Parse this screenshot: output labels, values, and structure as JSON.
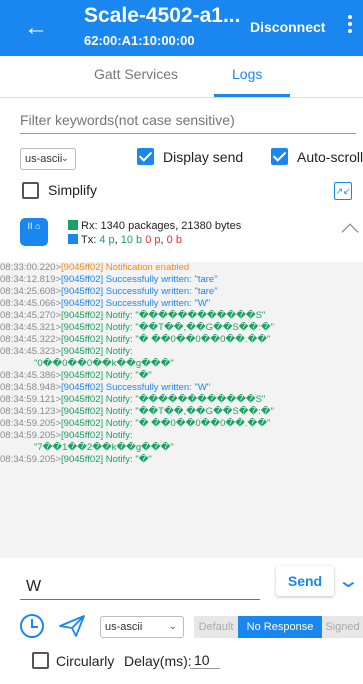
{
  "appbar": {
    "title": "Scale-4502-a1...",
    "address": "62:00:A1:10:00:00",
    "disconnect_label": "Disconnect",
    "back_icon": "arrow-left-icon",
    "more_icon": "more-vert-icon"
  },
  "tabs": [
    {
      "label": "Gatt Services",
      "selected": false
    },
    {
      "label": "Logs",
      "selected": true
    }
  ],
  "filter": {
    "placeholder": "Filter keywords(not case sensitive)",
    "value": ""
  },
  "options": {
    "encoding": "us-ascii",
    "display_send_label": "Display send",
    "display_send_checked": true,
    "auto_scroll_label": "Auto-scroll",
    "auto_scroll_checked": true,
    "simplify_label": "Simplify",
    "simplify_checked": false
  },
  "stats": {
    "icon_text": "II ⌂",
    "rx_label": "Rx: 1340 packages, 21380 bytes",
    "tx_prefix": "Tx: ",
    "tx_pkgs": "4 p",
    "tx_bytes": "10 b",
    "tx_p2": "0 p",
    "tx_b2": "0 b",
    "rx_color": "#1aa060",
    "tx_color": "#1a86f0"
  },
  "logs": [
    {
      "time": "08:33:00.220>",
      "msg": "[9045ff02] Notification enabled",
      "color": "orange"
    },
    {
      "time": "08:34:12.819>",
      "msg": "[9045ff02] Successfully written: \"tare\"",
      "color": "blue"
    },
    {
      "time": "08:34:25.608>",
      "msg": "[9045ff02] Successfully written: \"tare\"",
      "color": "blue"
    },
    {
      "time": "08:34:45.066>",
      "msg": "[9045ff02] Successfully written: \"W\"",
      "color": "blue"
    },
    {
      "time": "08:34:45.270>",
      "msg": "[9045ff02] Notify: \"������������S\"",
      "color": "green"
    },
    {
      "time": "08:34:45.321>",
      "msg": "[9045ff02] Notify: \"��T��,��G��S��:�\"",
      "color": "green"
    },
    {
      "time": "08:34:45.322>",
      "msg": "[9045ff02] Notify: \"� ��0��0��0��.��\"",
      "color": "green"
    },
    {
      "time": "08:34:45.323>",
      "msg": "[9045ff02] Notify:",
      "color": "green"
    },
    {
      "time": "",
      "msg": "\"0��0��0��k��g���\"",
      "color": "green"
    },
    {
      "time": "08:34:45.386>",
      "msg": "[9045ff02] Notify: \"�\"",
      "color": "green"
    },
    {
      "time": "08:34:58.948>",
      "msg": "[9045ff02] Successfully written: \"W\"",
      "color": "blue"
    },
    {
      "time": "08:34:59.121>",
      "msg": "[9045ff02] Notify: \"������������S\"",
      "color": "green"
    },
    {
      "time": "08:34:59.123>",
      "msg": "[9045ff02] Notify: \"��T��,��G��S��:�\"",
      "color": "green"
    },
    {
      "time": "08:34:59.205>",
      "msg": "[9045ff02] Notify: \"� ��0��0��0��.��\"",
      "color": "green"
    },
    {
      "time": "08:34:59.205>",
      "msg": "[9045ff02] Notify:",
      "color": "green"
    },
    {
      "time": "",
      "msg": "\"7��1��2��k��g���\"",
      "color": "green"
    },
    {
      "time": "08:34:59.205>",
      "msg": "[9045ff02] Notify: \"�\"",
      "color": "green"
    }
  ],
  "send": {
    "input_value": "W",
    "send_label": "Send",
    "expand_icon": "double-chevron-down-icon"
  },
  "bottom": {
    "clock_icon": "clock-icon",
    "send_icon": "paper-plane-icon",
    "encoding": "us-ascii",
    "write_types": [
      "Default",
      "No Response",
      "Signed"
    ],
    "selected_write_type": "No Response",
    "circularly_label": "Circularly",
    "circularly_checked": false,
    "delay_label": "Delay(ms):",
    "delay_value": "10"
  }
}
